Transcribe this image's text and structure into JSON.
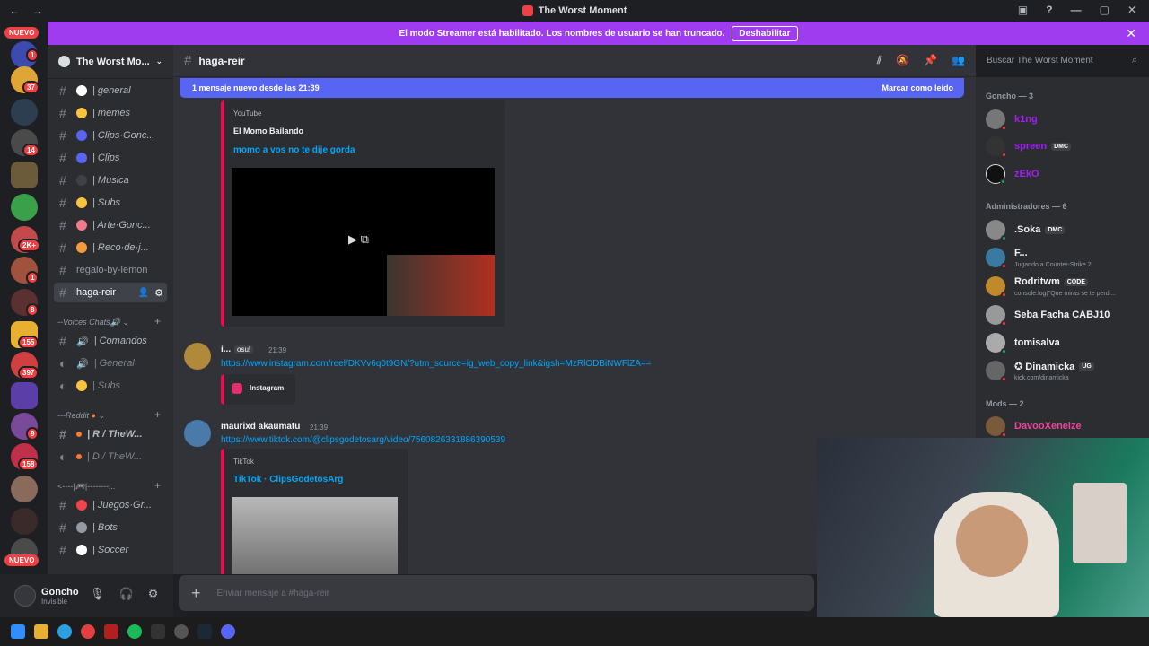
{
  "window": {
    "title": "The Worst Moment"
  },
  "banner": {
    "text": "El modo Streamer está habilitado. Los nombres de usuario se han truncado.",
    "button": "Deshabilitar"
  },
  "guilds": {
    "new_top": "NUEVO",
    "new_bottom": "NUEVO",
    "badges": [
      "8",
      "1",
      "37",
      "14",
      "2K+",
      "1",
      "8",
      "155",
      "397",
      "9",
      "158"
    ]
  },
  "server": {
    "name": "The Worst Mo..."
  },
  "channels": [
    {
      "name": "| general",
      "color": "#ffffff"
    },
    {
      "name": "| memes",
      "color": "#f9c43d"
    },
    {
      "name": "| Clips·Gonc...",
      "color": "#5865f2"
    },
    {
      "name": "| Clips",
      "color": "#5865f2"
    },
    {
      "name": "| Musica",
      "color": "#3f4147"
    },
    {
      "name": "| Subs",
      "color": "#f9c43d"
    },
    {
      "name": "| Arte·Gonc...",
      "color": "#f27a8b"
    },
    {
      "name": "| Reco·de·j...",
      "color": "#f79a3a"
    },
    {
      "name": "regalo-by-lemon",
      "color": ""
    },
    {
      "name": "haga-reir",
      "color": ""
    }
  ],
  "categories": {
    "voice": "--Voices Chats🔊",
    "reddit": "---Reddit",
    "juegos": "<----|🎮|--------..."
  },
  "voice_channels": [
    {
      "name": "| Comandos"
    },
    {
      "name": "| General"
    },
    {
      "name": "| Subs"
    }
  ],
  "reddit_channels": [
    {
      "name": "| R / TheW..."
    },
    {
      "name": "| D / TheW..."
    }
  ],
  "game_channels": [
    {
      "name": "| Juegos·Gr..."
    },
    {
      "name": "| Bots"
    },
    {
      "name": "| Soccer"
    }
  ],
  "user": {
    "name": "Goncho",
    "status": "Invisible"
  },
  "chat": {
    "channel": "haga-reir",
    "search_placeholder": "Buscar The Worst Moment",
    "new_messages": "1 mensaje nuevo desde las 21:39",
    "mark_read": "Marcar como leído",
    "embed1": {
      "provider": "YouTube",
      "title": "El Momo Bailando",
      "desc": "momo a vos no te dije gorda"
    },
    "msg1": {
      "author": "i...",
      "tag": "osu!",
      "time": "21:39",
      "link": "https://www.instagram.com/reel/DKVv6q0t9GN/?utm_source=ig_web_copy_link&igsh=MzRlODBiNWFlZA==",
      "embed": "Instagram"
    },
    "msg2": {
      "author": "maurixd akaumatu",
      "time": "21:39",
      "link": "https://www.tiktok.com/@clipsgodetosarg/video/7560826331886390539",
      "embed_provider": "TikTok",
      "embed_title": "TikTok · ClipsGodetosArg"
    },
    "composer_placeholder": "Enviar mensaje a #haga-reir"
  },
  "members": {
    "groups": [
      {
        "header": "Goncho — 3",
        "items": [
          {
            "name": "k1ng",
            "color": "#a020f0",
            "status": "#f23f43"
          },
          {
            "name": "spreen",
            "color": "#a020f0",
            "tag": "DMC",
            "status": "#f23f43"
          },
          {
            "name": "zEkO",
            "color": "#a020f0",
            "status": "#23a55a"
          }
        ]
      },
      {
        "header": "Administradores — 6",
        "items": [
          {
            "name": ".Soka",
            "color": "#f2f3f5",
            "tag": "DMC",
            "status": "#23a55a"
          },
          {
            "name": "F...",
            "color": "#f2f3f5",
            "sub": "Jugando a Counter-Strike 2",
            "status": "#f23f43"
          },
          {
            "name": "Rodritwm",
            "color": "#f2f3f5",
            "tag": "CODE",
            "sub": "console.log(\"Que miras se te perdi...",
            "status": "#f23f43"
          },
          {
            "name": "Seba Facha CABJ10",
            "color": "#f2f3f5",
            "status": "#f23f43"
          },
          {
            "name": "tomisalva",
            "color": "#f2f3f5",
            "status": "#23a55a"
          },
          {
            "name": "✪ Dinamicka",
            "color": "#f2f3f5",
            "tag": "UG",
            "sub": "kick.com/dinamicka",
            "status": "#f23f43"
          }
        ]
      },
      {
        "header": "Mods — 2",
        "items": [
          {
            "name": "DavooXeneize",
            "color": "#eb459e",
            "status": "#f23f43"
          }
        ]
      }
    ]
  }
}
